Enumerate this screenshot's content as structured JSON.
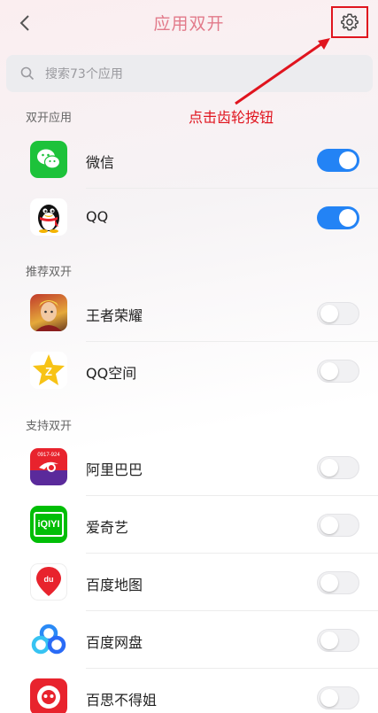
{
  "header": {
    "title": "应用双开"
  },
  "search": {
    "placeholder": "搜索73个应用"
  },
  "annotation": {
    "text": "点击齿轮按钮",
    "color": "#e0141e"
  },
  "sections": [
    {
      "title": "双开应用",
      "apps": [
        {
          "name": "微信",
          "icon": "wechat-icon",
          "enabled": true
        },
        {
          "name": "QQ",
          "icon": "qq-penguin-icon",
          "enabled": true
        }
      ]
    },
    {
      "title": "推荐双开",
      "apps": [
        {
          "name": "王者荣耀",
          "icon": "honor-of-kings-icon",
          "enabled": false
        },
        {
          "name": "QQ空间",
          "icon": "qzone-star-icon",
          "enabled": false
        }
      ]
    },
    {
      "title": "支持双开",
      "apps": [
        {
          "name": "阿里巴巴",
          "icon": "alibaba-icon",
          "enabled": false
        },
        {
          "name": "爱奇艺",
          "icon": "iqiyi-icon",
          "enabled": false
        },
        {
          "name": "百度地图",
          "icon": "baidu-map-icon",
          "enabled": false
        },
        {
          "name": "百度网盘",
          "icon": "baidu-netdisk-icon",
          "enabled": false
        },
        {
          "name": "百思不得姐",
          "icon": "baisibudejie-icon",
          "enabled": false
        }
      ]
    }
  ],
  "colors": {
    "accent": "#2383f5",
    "title": "#e27a8a",
    "highlight": "#e0141e"
  },
  "iconText": {
    "alibaba_top": "0917-924",
    "iqiyi": "iQIYI",
    "baidu": "du"
  }
}
